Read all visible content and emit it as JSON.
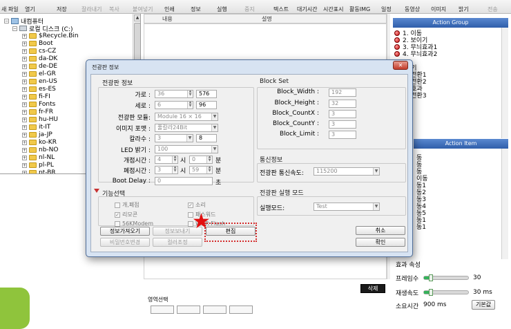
{
  "toolbar": {
    "items": [
      {
        "label": "새 파일",
        "enabled": true
      },
      {
        "label": "열기",
        "enabled": true
      },
      {
        "label": "저장",
        "enabled": true
      },
      {
        "label": "잘라내기",
        "enabled": false
      },
      {
        "label": "복사",
        "enabled": false
      },
      {
        "label": "붙여넣기",
        "enabled": false
      },
      {
        "label": "인쇄",
        "enabled": true
      },
      {
        "label": "정보",
        "enabled": true
      },
      {
        "label": "실행",
        "enabled": true
      },
      {
        "label": "중지",
        "enabled": false
      },
      {
        "label": "텍스트",
        "enabled": true
      },
      {
        "label": "대기시간",
        "enabled": true
      },
      {
        "label": "시간표시",
        "enabled": true
      },
      {
        "label": "활동IMG",
        "enabled": true
      },
      {
        "label": "일정",
        "enabled": true
      },
      {
        "label": "동영상",
        "enabled": true
      },
      {
        "label": "이미지",
        "enabled": true
      },
      {
        "label": "밝기",
        "enabled": true
      },
      {
        "label": "전송",
        "enabled": false
      }
    ]
  },
  "tree": {
    "root": "내컴퓨터",
    "drive": "로컬 디스크 (C:)",
    "items": [
      "$Recycle.Bin",
      "Boot",
      "cs-CZ",
      "da-DK",
      "de-DE",
      "el-GR",
      "en-US",
      "es-ES",
      "fi-FI",
      "Fonts",
      "fr-FR",
      "hu-HU",
      "it-IT",
      "ja-JP",
      "ko-KR",
      "nb-NO",
      "nl-NL",
      "pl-PL",
      "pt-BR"
    ]
  },
  "midpane": {
    "col_name": "내용",
    "col_desc": "설명"
  },
  "action_group": {
    "title": "Action Group",
    "items": [
      "1. 이동",
      "2. 보이기",
      "3. 무늬효과1",
      "4. 무늬효과2",
      "",
      "기기",
      "연전환1",
      "연전환2",
      "기호과",
      "연전환3"
    ]
  },
  "action_item": {
    "title": "Action Item",
    "items": [
      "동",
      "동",
      "동",
      "이동",
      "동1",
      "동2",
      "동3",
      "동4",
      "동5",
      "동1",
      "동1"
    ]
  },
  "effect_props": {
    "title": "효과 속성",
    "frame_label": "프레임수",
    "frame_value": "30",
    "frame_level": 0.15,
    "speed_label": "재생속도",
    "speed_value": "30 ms",
    "speed_level": 0.15,
    "time_label": "소요시간",
    "time_value": "900 ms",
    "default_btn": "기본값"
  },
  "delete_btn": "삭제",
  "area_select": "영역선택",
  "dialog": {
    "title": "전광판 정보",
    "close": "✕",
    "board_info_title": "전광판 정보",
    "fields": {
      "width_label": "가로 :",
      "width_val": "36",
      "width_px": "576",
      "height_label": "세로 :",
      "height_val": "6",
      "height_px": "96",
      "module_label": "전광판 모듈:",
      "module_val": "Module 16 × 16",
      "format_label": "이미지 포맷 :",
      "format_val": "풀칼라24Bit",
      "col_label": "칼라수 :",
      "col_val": "3",
      "col_val2": "8",
      "led_label": "LED 밝기 :",
      "led_val": "100",
      "open_label": "개점시간 :",
      "open_h": "4",
      "open_h_unit": "시",
      "open_m": "0",
      "open_m_unit": "분",
      "close_label": "폐점시간 :",
      "close_h": "3",
      "close_h_unit": "시",
      "close_m": "59",
      "close_m_unit": "분",
      "boot_label": "Boot Delay :",
      "boot_val": "0",
      "boot_unit": "초"
    },
    "func_title": "기능선택",
    "checks": [
      {
        "label": "개,폐점",
        "checked": false
      },
      {
        "label": "소리",
        "checked": true
      },
      {
        "label": "리모콘",
        "checked": true
      },
      {
        "label": "패스워드",
        "checked": false
      },
      {
        "label": "56KModem",
        "checked": false
      },
      {
        "label": "WOR Flash",
        "checked": false
      }
    ],
    "block_set": {
      "title": "Block Set",
      "width_label": "Block_Width :",
      "width_val": "192",
      "height_label": "Block_Height :",
      "height_val": "32",
      "countx_label": "Block_CountX :",
      "countx_val": "3",
      "county_label": "Block_CountY :",
      "county_val": "3",
      "limit_label": "Block_Limit :",
      "limit_val": "3"
    },
    "comm": {
      "title": "통신정보",
      "label": "전광판 통신속도:",
      "value": "115200"
    },
    "run": {
      "title": "전광판 실행 모드",
      "label": "실행모드:",
      "value": "Test"
    },
    "buttons": {
      "get_info": "정보가져오기",
      "send_info": "정보보내기",
      "edit": "편집",
      "change_pw": "비밀번호변경",
      "color_adjust": "컬러조정",
      "cancel": "취소",
      "ok": "확인"
    }
  },
  "colors": {
    "title_blue": "#2f5eaa",
    "highlight": "#d42a2a",
    "green": "#8fc43c"
  }
}
